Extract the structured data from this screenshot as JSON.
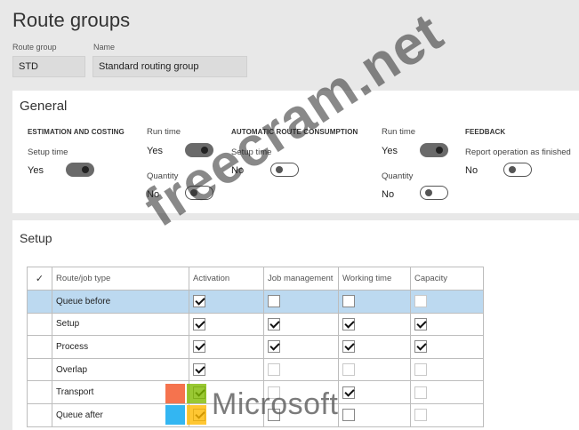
{
  "page": {
    "title": "Route groups"
  },
  "header_fields": {
    "route_group_label": "Route group",
    "route_group_value": "STD",
    "name_label": "Name",
    "name_value": "Standard routing group"
  },
  "general": {
    "title": "General",
    "estimation": {
      "heading": "ESTIMATION AND COSTING",
      "setup_time_label": "Setup time",
      "setup_time_value": "Yes",
      "run_time_label": "Run time",
      "run_time_value": "Yes",
      "quantity_label": "Quantity",
      "quantity_value": "No"
    },
    "consumption": {
      "heading": "AUTOMATIC ROUTE CONSUMPTION",
      "setup_time_label": "Setup time",
      "setup_time_value": "No",
      "run_time_label": "Run time",
      "run_time_value": "Yes",
      "quantity_label": "Quantity",
      "quantity_value": "No"
    },
    "feedback": {
      "heading": "FEEDBACK",
      "report_label": "Report operation as finished",
      "report_value": "No"
    }
  },
  "setup": {
    "title": "Setup",
    "header_check": "✓",
    "columns": [
      "Route/job type",
      "Activation",
      "Job management",
      "Working time",
      "Capacity"
    ],
    "rows": [
      {
        "type": "Queue before",
        "activation": true,
        "job": false,
        "work": false,
        "capacity": false,
        "capacity_disabled": true,
        "selected": true
      },
      {
        "type": "Setup",
        "activation": true,
        "job": true,
        "work": true,
        "capacity": true
      },
      {
        "type": "Process",
        "activation": true,
        "job": true,
        "work": true,
        "capacity": true
      },
      {
        "type": "Overlap",
        "activation": true,
        "job": false,
        "work": false,
        "capacity": false,
        "job_disabled": true,
        "work_disabled": true,
        "capacity_disabled": true
      },
      {
        "type": "Transport",
        "activation": true,
        "job": false,
        "work": true,
        "capacity": false,
        "job_disabled": true,
        "capacity_disabled": true
      },
      {
        "type": "Queue after",
        "activation": true,
        "job": false,
        "work": false,
        "capacity": false,
        "capacity_disabled": true
      }
    ]
  },
  "overlay": {
    "watermark": "freecram.net",
    "ms_text": "Microsoft",
    "ms_colors": [
      "#f25022",
      "#7fba00",
      "#00a4ef",
      "#ffb900"
    ]
  }
}
